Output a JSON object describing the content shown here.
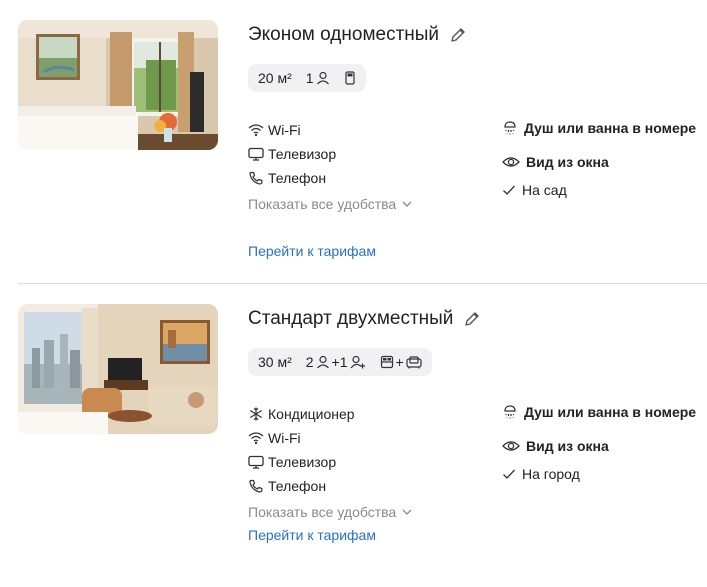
{
  "rooms": [
    {
      "name": "Эконом одноместный",
      "area": "20 м²",
      "guests": "1",
      "extra_guests": "",
      "amenities": [
        {
          "icon": "wifi-icon",
          "label": "Wi-Fi"
        },
        {
          "icon": "tv-icon",
          "label": "Телевизор"
        },
        {
          "icon": "phone-icon",
          "label": "Телефон"
        }
      ],
      "show_all": "Показать все удобства",
      "bathroom": "Душ или ванна в номере",
      "view_title": "Вид из окна",
      "view_value": "На сад",
      "tariffs_link": "Перейти к тарифам"
    },
    {
      "name": "Стандарт двухместный",
      "area": "30 м²",
      "guests": "2",
      "extra_guests": "+1",
      "amenities": [
        {
          "icon": "snowflake-icon",
          "label": "Кондиционер"
        },
        {
          "icon": "wifi-icon",
          "label": "Wi-Fi"
        },
        {
          "icon": "tv-icon",
          "label": "Телевизор"
        },
        {
          "icon": "phone-icon",
          "label": "Телефон"
        }
      ],
      "show_all": "Показать все удобства",
      "bathroom": "Душ или ванна в номере",
      "view_title": "Вид из окна",
      "view_value": "На город",
      "tariffs_link": "Перейти к тарифам"
    }
  ],
  "colors": {
    "link": "#2b6fc7",
    "muted": "#8a8a8a",
    "chip_bg": "#f1f1f3",
    "divider": "#dcdcdc"
  }
}
